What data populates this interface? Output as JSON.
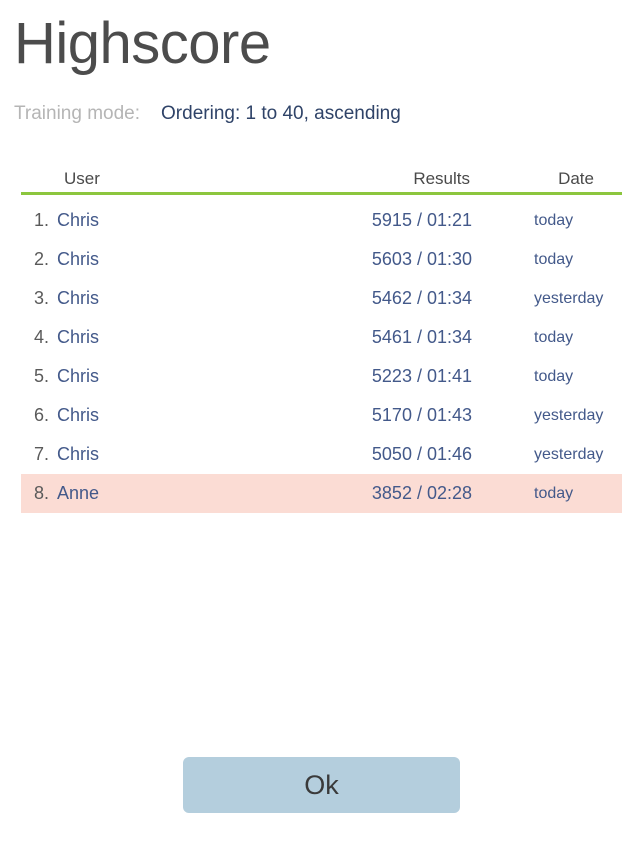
{
  "header": {
    "title": "Highscore",
    "mode_label": "Training mode:",
    "mode_value": "Ordering: 1 to 40, ascending"
  },
  "table": {
    "columns": {
      "rank": "",
      "user": "User",
      "results": "Results",
      "date": "Date"
    },
    "rows": [
      {
        "rank": "1.",
        "user": "Chris",
        "results": "5915 / 01:21",
        "date": "today",
        "highlight": false
      },
      {
        "rank": "2.",
        "user": "Chris",
        "results": "5603 / 01:30",
        "date": "today",
        "highlight": false
      },
      {
        "rank": "3.",
        "user": "Chris",
        "results": "5462 / 01:34",
        "date": "yesterday",
        "highlight": false
      },
      {
        "rank": "4.",
        "user": "Chris",
        "results": "5461 / 01:34",
        "date": "today",
        "highlight": false
      },
      {
        "rank": "5.",
        "user": "Chris",
        "results": "5223 / 01:41",
        "date": "today",
        "highlight": false
      },
      {
        "rank": "6.",
        "user": "Chris",
        "results": "5170 / 01:43",
        "date": "yesterday",
        "highlight": false
      },
      {
        "rank": "7.",
        "user": "Chris",
        "results": "5050 / 01:46",
        "date": "yesterday",
        "highlight": false
      },
      {
        "rank": "8.",
        "user": "Anne",
        "results": "3852 / 02:28",
        "date": "today",
        "highlight": true
      }
    ]
  },
  "footer": {
    "ok_label": "Ok"
  },
  "colors": {
    "accent_green": "#8cc63e",
    "highlight_pink": "#fbdcd4",
    "button_blue": "#b4cedd",
    "text_blue": "#43598a",
    "title_gray": "#4c4c4c",
    "muted_gray": "#b5b5b5"
  }
}
